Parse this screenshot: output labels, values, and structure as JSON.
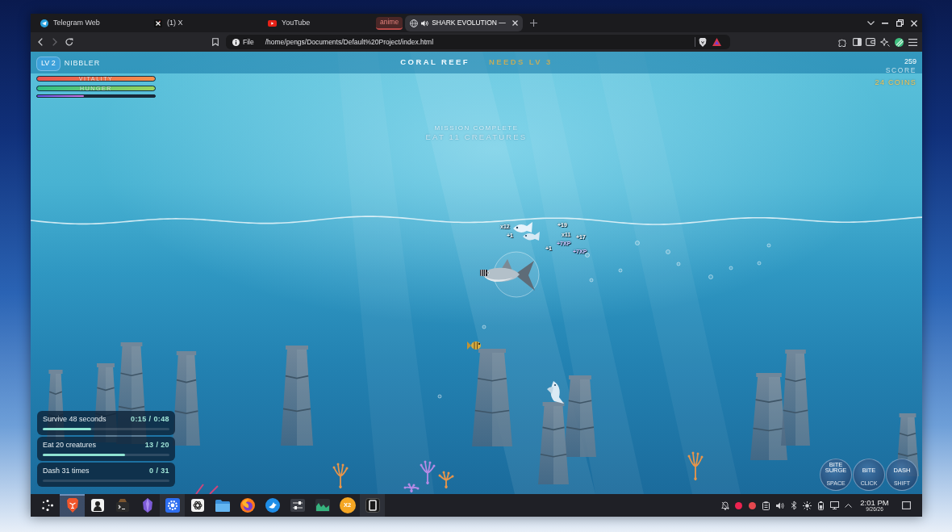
{
  "browser": {
    "tabs": [
      {
        "kind": "tab",
        "label": "Telegram Web",
        "selected": false,
        "playing_audio": false
      },
      {
        "kind": "tab",
        "label": "(1) X",
        "selected": false,
        "playing_audio": false
      },
      {
        "kind": "tab",
        "label": "YouTube",
        "selected": false,
        "playing_audio": false
      },
      {
        "kind": "group",
        "label": "anime",
        "selected": false
      },
      {
        "kind": "tab",
        "label": "SHARK EVOLUTION —",
        "selected": true,
        "playing_audio": true
      }
    ],
    "navigation": {
      "back_disabled": false,
      "forward_disabled": true
    },
    "address": {
      "scheme": "File",
      "url": "/home/pengs/Documents/Default%20Project/index.html"
    }
  },
  "game": {
    "hud": {
      "level": "LV 2",
      "rank": "NIBBLER",
      "zone": "CORAL REEF",
      "zone_requirement": "NEEDS LV 3",
      "score": "259",
      "score_label": "SCORE",
      "coins": "24 COINS",
      "meters": [
        {
          "kind": "vitality",
          "label": "VITALITY",
          "level": 1
        },
        {
          "kind": "hunger",
          "label": "HUNGER",
          "level": 1
        },
        {
          "kind": "xp",
          "level": 0.4
        }
      ]
    },
    "announcement": {
      "title": "MISSION COMPLETE",
      "detail": "EAT 11 CREATURES"
    },
    "popups": [
      {
        "kind": "combo",
        "text": "x12"
      },
      {
        "kind": "score",
        "text": "+1"
      },
      {
        "kind": "score",
        "text": "+19"
      },
      {
        "kind": "combo",
        "text": "x11"
      },
      {
        "kind": "score",
        "text": "+17"
      },
      {
        "kind": "xp",
        "text": "+7XP"
      },
      {
        "kind": "score",
        "text": "+1"
      },
      {
        "kind": "xp",
        "text": "+7XP"
      }
    ],
    "missions": [
      {
        "label": "Survive 48 seconds",
        "progress": "0:15 / 0:48",
        "level": 0.38
      },
      {
        "label": "Eat 20 creatures",
        "progress": "13 / 20",
        "level": 0.65
      },
      {
        "label": "Dash 31 times",
        "progress": "0 / 31",
        "level": 0
      }
    ],
    "abilities": [
      {
        "label": "BITE SURGE",
        "key": "SPACE"
      },
      {
        "label": "BITE",
        "key": "CLICK"
      },
      {
        "label": "DASH",
        "key": "SHIFT"
      }
    ]
  },
  "taskbar": {
    "apps": [
      {
        "selected": false,
        "open": false
      },
      {
        "selected": true,
        "open": true
      },
      {
        "selected": false,
        "open": false
      },
      {
        "selected": false,
        "open": false
      },
      {
        "selected": false,
        "open": false
      },
      {
        "selected": false,
        "open": true
      },
      {
        "selected": false,
        "open": false
      },
      {
        "selected": false,
        "open": false
      },
      {
        "selected": false,
        "open": false
      },
      {
        "selected": false,
        "open": false
      },
      {
        "selected": false,
        "open": false
      },
      {
        "selected": false,
        "open": false
      },
      {
        "selected": false,
        "open": false,
        "label": "X2"
      },
      {
        "selected": false,
        "open": true
      }
    ],
    "clock": {
      "time": "2:01 PM",
      "date": "9/26/26"
    }
  }
}
